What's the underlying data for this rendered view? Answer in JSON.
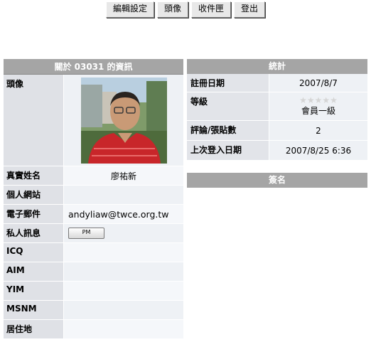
{
  "toolbar": {
    "edit_settings": "編輯設定",
    "avatar": "頭像",
    "inbox": "收件匣",
    "logout": "登出"
  },
  "profile": {
    "header": "關於 03031 的資訊",
    "rows": [
      {
        "label": "頭像",
        "value": ""
      },
      {
        "label": "真實姓名",
        "value": "廖祐新"
      },
      {
        "label": "個人網站",
        "value": ""
      },
      {
        "label": "電子郵件",
        "value": "andyliaw@twce.org.tw"
      },
      {
        "label": "私人訊息",
        "value": ""
      },
      {
        "label": "ICQ",
        "value": ""
      },
      {
        "label": "AIM",
        "value": ""
      },
      {
        "label": "YIM",
        "value": ""
      },
      {
        "label": "MSNM",
        "value": ""
      },
      {
        "label": "居住地",
        "value": ""
      }
    ],
    "pm_button": "PM"
  },
  "stats": {
    "header": "統計",
    "rows": [
      {
        "label": "註冊日期",
        "value": "2007/8/7"
      },
      {
        "label": "等級",
        "value": "會員一級",
        "stars": "★★★★★"
      },
      {
        "label": "評論/張貼數",
        "value": "2"
      },
      {
        "label": "上次登入日期",
        "value": "2007/8/25 6:36"
      }
    ]
  },
  "signature": {
    "header": "簽名"
  }
}
